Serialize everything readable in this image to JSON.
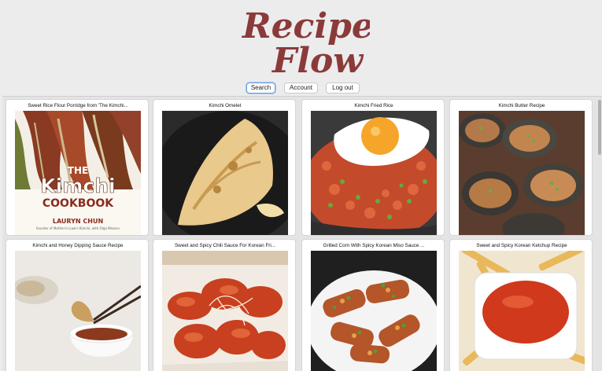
{
  "app": {
    "logo_line1": "Recipe",
    "logo_line2": "Flow",
    "brand_color": "#8b3a3a"
  },
  "nav": {
    "search_label": "Search",
    "account_label": "Account",
    "logout_label": "Log out"
  },
  "recipes": [
    {
      "title": "Sweet Rice Flour Porridge from 'The Kimchi...",
      "image": "kimchi-cookbook-cover",
      "cover_title_1": "THE",
      "cover_title_2": "Kimchi",
      "cover_title_3": "COOKBOOK",
      "cover_author": "LAURYN CHUN",
      "cover_subtitle": "founder of Mother-in-Law's Kimchi, with Olga Massov"
    },
    {
      "title": "Kimchi Omelet",
      "image": "omelet"
    },
    {
      "title": "Kimchi Fried Rice",
      "image": "fried-rice-with-egg"
    },
    {
      "title": "Kimchi Butter Recipe",
      "image": "grilled-oysters"
    },
    {
      "title": "Kimchi and Honey Dipping Sauce Recipe",
      "image": "dipping-sauce-with-chopsticks"
    },
    {
      "title": "Sweet and Spicy Chili Sauce For Korean Fri...",
      "image": "korean-fried-chicken"
    },
    {
      "title": "Grilled Corn With Spicy Korean Miso Sauce ...",
      "image": "grilled-corn"
    },
    {
      "title": "Sweet and Spicy Korean Ketchup Recipe",
      "image": "ketchup-with-fries"
    }
  ]
}
